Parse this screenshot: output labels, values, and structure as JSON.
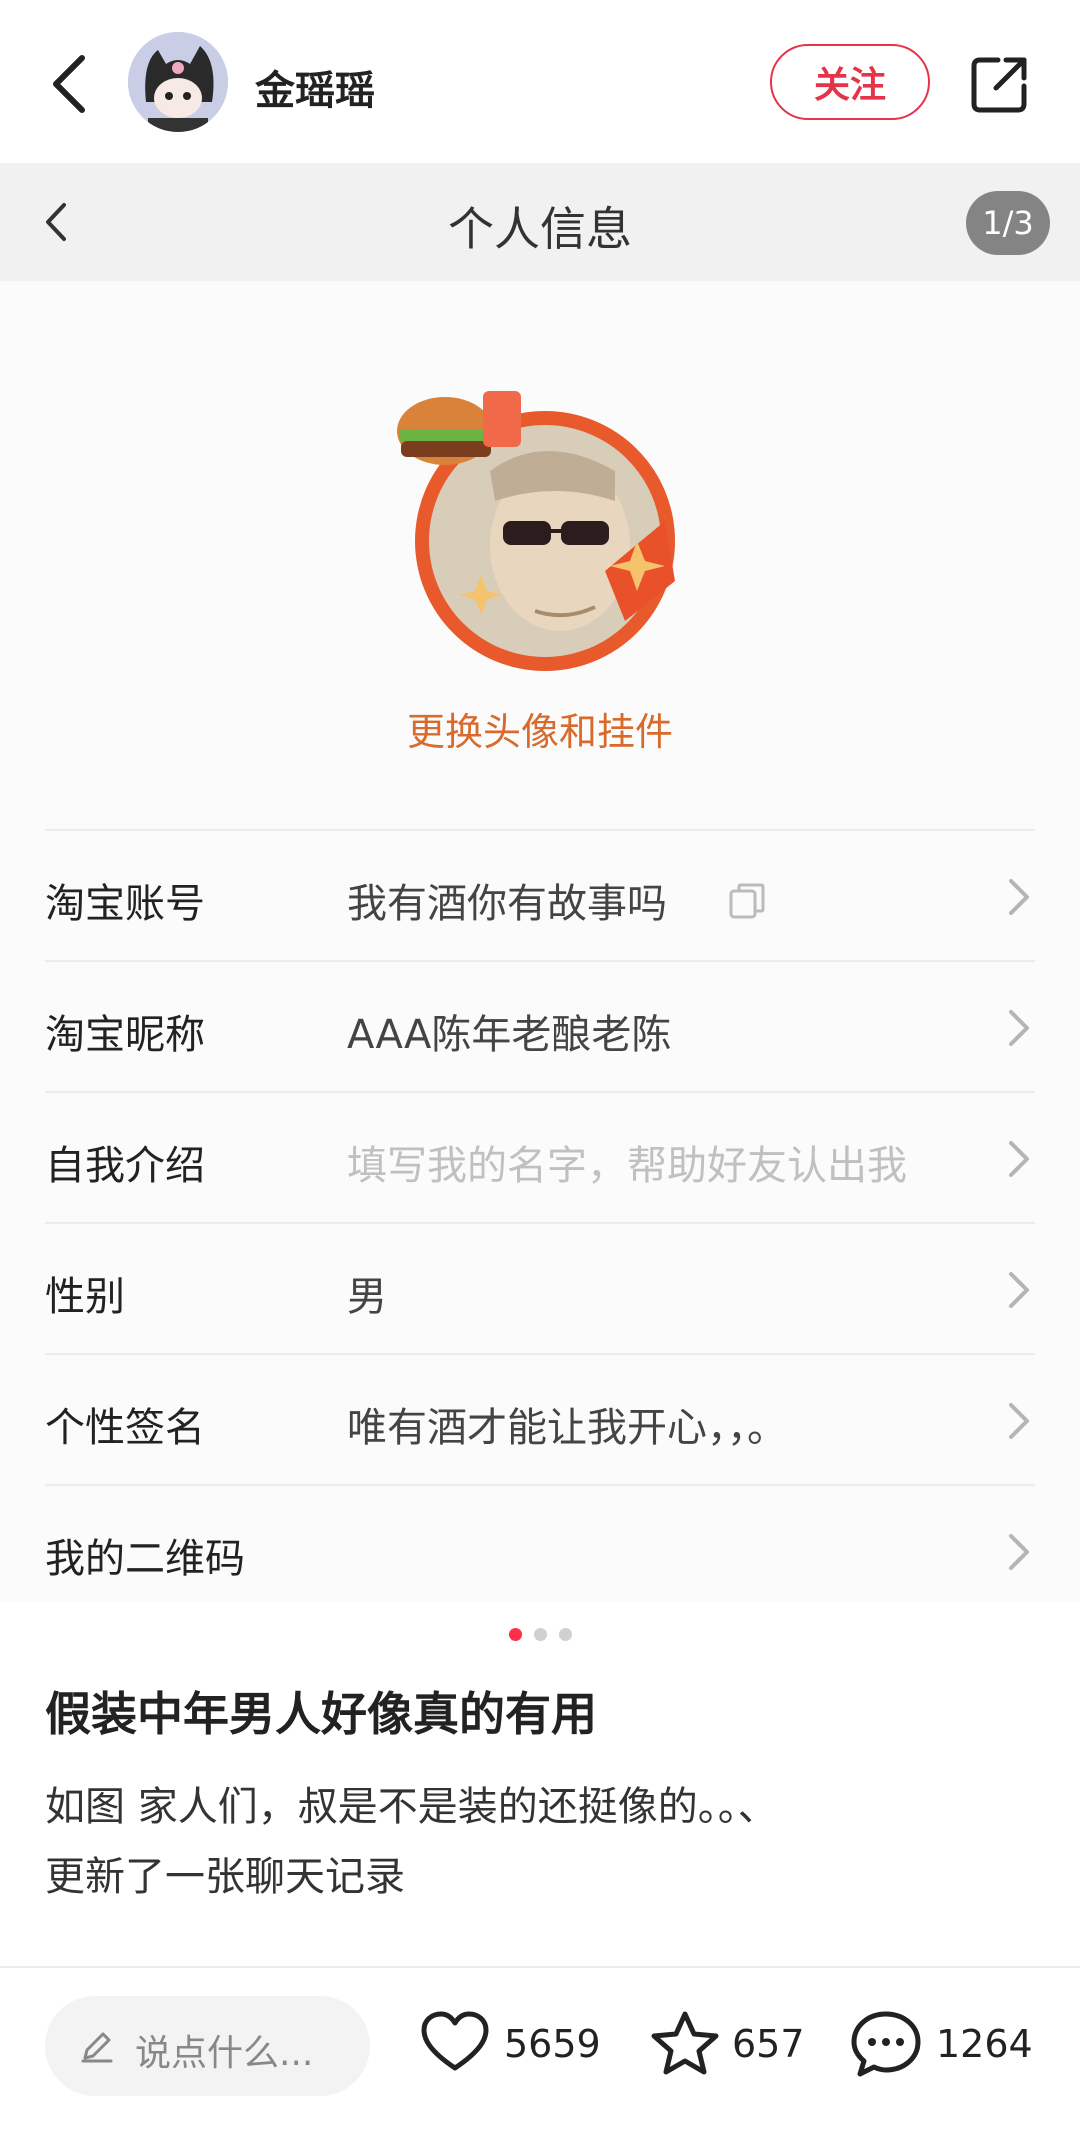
{
  "header": {
    "username": "金瑶瑶",
    "follow_label": "关注"
  },
  "screenshot": {
    "title": "个人信息",
    "page_indicator": "1/3",
    "change_avatar_label": "更换头像和挂件",
    "rows": [
      {
        "label": "淘宝账号",
        "value": "我有酒你有故事吗"
      },
      {
        "label": "淘宝昵称",
        "value": "AAA陈年老酿老陈"
      },
      {
        "label": "自我介绍",
        "value": "填写我的名字，帮助好友认出我"
      },
      {
        "label": "性别",
        "value": "男"
      },
      {
        "label": "个性签名",
        "value": "唯有酒才能让我开心，，。"
      },
      {
        "label": "我的二维码",
        "value": ""
      }
    ]
  },
  "carousel": {
    "total": 3,
    "active": 1
  },
  "post": {
    "title": "假装中年男人好像真的有用",
    "line1": "如图 家人们，叔是不是装的还挺像的。。、",
    "line2": "更新了一张聊天记录"
  },
  "bottom_bar": {
    "comment_placeholder": "说点什么...",
    "likes": "5659",
    "favorites": "657",
    "comments": "1264"
  },
  "colors": {
    "accent": "#e5344a",
    "avatar_link": "#d86a2c",
    "placeholder": "#c0c0c0"
  }
}
